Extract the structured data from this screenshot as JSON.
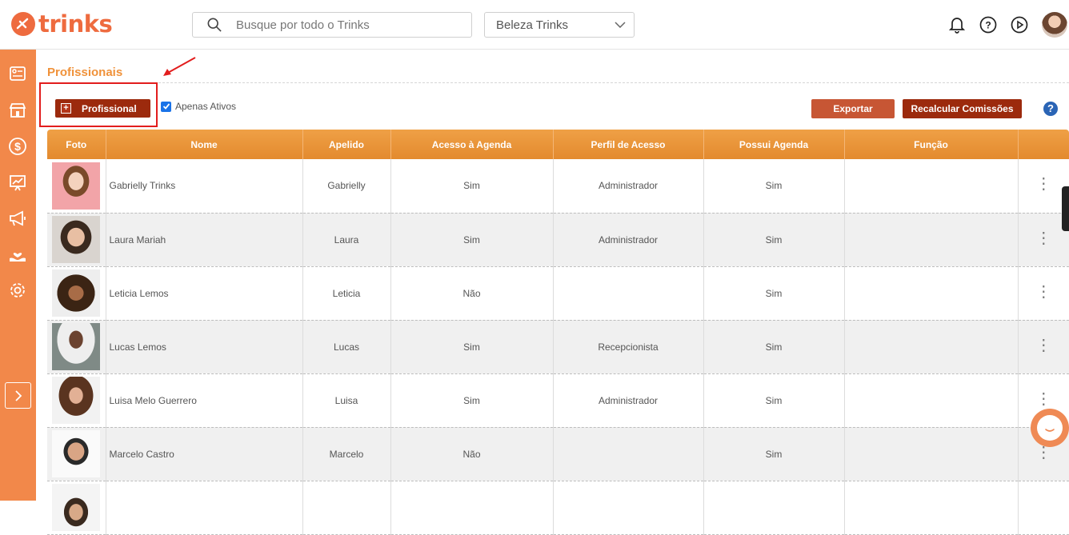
{
  "brand": {
    "name": "trinks",
    "color": "#ee6b3f"
  },
  "search": {
    "placeholder": "Busque por todo o Trinks"
  },
  "company_select": {
    "value": "Beleza Trinks"
  },
  "header_icons": [
    "bell-icon",
    "help-circle-icon",
    "play-circle-icon"
  ],
  "sidebar": {
    "items": [
      "dashboard-icon",
      "store-icon",
      "dollar-icon",
      "chart-icon",
      "megaphone-icon",
      "hand-heart-icon",
      "gear-icon"
    ],
    "color": "#f2884a"
  },
  "page": {
    "title": "Profissionais",
    "add_button": "Profissional",
    "add_button_icon": "+",
    "only_active_label": "Apenas Ativos",
    "export_button": "Exportar",
    "recalc_button": "Recalcular Comissões",
    "help": "?"
  },
  "table": {
    "headers": [
      "Foto",
      "Nome",
      "Apelido",
      "Acesso à Agenda",
      "Perfil de Acesso",
      "Possui Agenda",
      "Função",
      ""
    ],
    "rows": [
      {
        "name": "Gabrielly Trinks",
        "nickname": "Gabrielly",
        "agenda_access": "Sim",
        "profile": "Administrador",
        "has_agenda": "Sim",
        "role": "",
        "actions": "⋮"
      },
      {
        "name": "Laura Mariah",
        "nickname": "Laura",
        "agenda_access": "Sim",
        "profile": "Administrador",
        "has_agenda": "Sim",
        "role": "",
        "actions": "⋮"
      },
      {
        "name": "Leticia Lemos",
        "nickname": "Leticia",
        "agenda_access": "Não",
        "profile": "",
        "has_agenda": "Sim",
        "role": "",
        "actions": "⋮"
      },
      {
        "name": "Lucas Lemos",
        "nickname": "Lucas",
        "agenda_access": "Sim",
        "profile": "Recepcionista",
        "has_agenda": "Sim",
        "role": "",
        "actions": "⋮"
      },
      {
        "name": "Luisa Melo Guerrero",
        "nickname": "Luisa",
        "agenda_access": "Sim",
        "profile": "Administrador",
        "has_agenda": "Sim",
        "role": "",
        "actions": "⋮"
      },
      {
        "name": "Marcelo Castro",
        "nickname": "Marcelo",
        "agenda_access": "Não",
        "profile": "",
        "has_agenda": "Sim",
        "role": "",
        "actions": "⋮"
      },
      {
        "name": "",
        "nickname": "",
        "agenda_access": "",
        "profile": "",
        "has_agenda": "",
        "role": "",
        "actions": ""
      }
    ]
  }
}
